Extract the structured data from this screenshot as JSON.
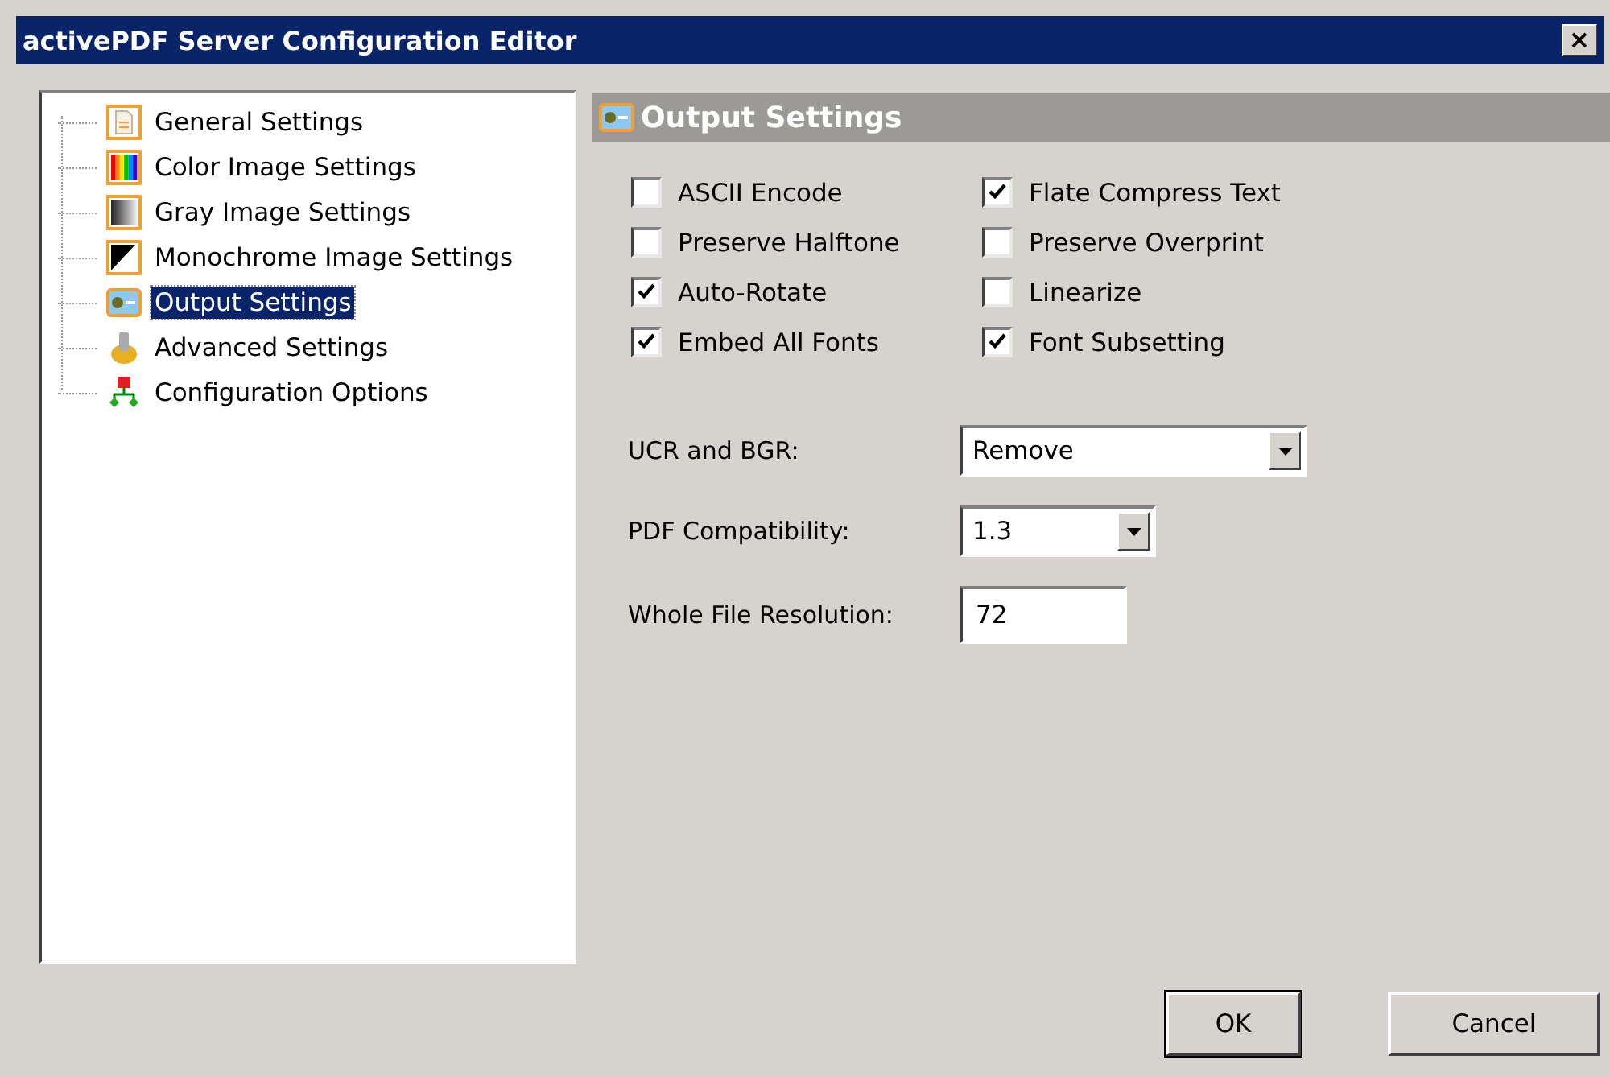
{
  "window": {
    "title": "activePDF Server Configuration Editor",
    "close": "×"
  },
  "tree": {
    "items": [
      {
        "label": "General Settings",
        "kind": "document",
        "selected": false
      },
      {
        "label": "Color Image Settings",
        "kind": "color",
        "selected": false
      },
      {
        "label": "Gray Image Settings",
        "kind": "gray",
        "selected": false
      },
      {
        "label": "Monochrome Image Settings",
        "kind": "mono",
        "selected": false
      },
      {
        "label": "Output Settings",
        "kind": "output",
        "selected": true
      },
      {
        "label": "Advanced Settings",
        "kind": "advanced",
        "selected": false
      },
      {
        "label": "Configuration Options",
        "kind": "config",
        "selected": false
      }
    ]
  },
  "panel": {
    "title": "Output Settings",
    "options": [
      {
        "label": "ASCII Encode",
        "checked": false
      },
      {
        "label": "Flate Compress Text",
        "checked": true
      },
      {
        "label": "Preserve Halftone",
        "checked": false
      },
      {
        "label": "Preserve Overprint",
        "checked": false
      },
      {
        "label": "Auto-Rotate",
        "checked": true
      },
      {
        "label": "Linearize",
        "checked": false
      },
      {
        "label": "Embed All Fonts",
        "checked": true
      },
      {
        "label": "Font Subsetting",
        "checked": true
      }
    ],
    "fields": [
      {
        "label": "UCR and BGR:",
        "kind": "dropdown",
        "value": "Remove",
        "wide": true
      },
      {
        "label": "PDF Compatibility:",
        "kind": "dropdown",
        "value": "1.3",
        "wide": false
      },
      {
        "label": "Whole File Resolution:",
        "kind": "text",
        "value": "72",
        "wide": false
      }
    ]
  },
  "buttons": [
    "OK",
    "Cancel"
  ]
}
